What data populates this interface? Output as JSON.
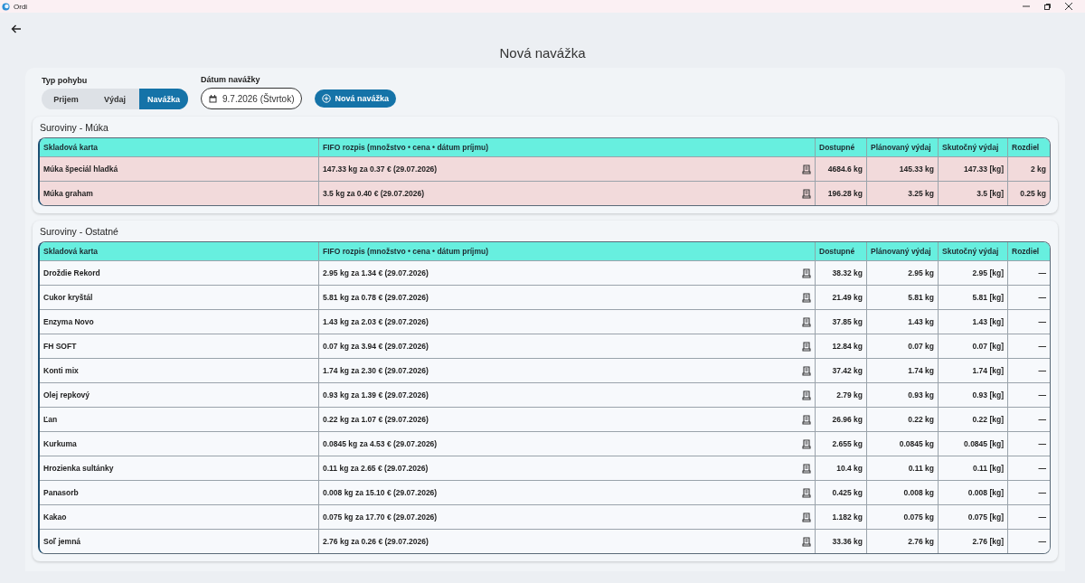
{
  "window": {
    "title": "Ordi"
  },
  "page": {
    "title": "Nová navážka"
  },
  "filters": {
    "movement_type": {
      "label": "Typ pohybu",
      "options": [
        {
          "label": "Prijem",
          "selected": false
        },
        {
          "label": "Výdaj",
          "selected": false
        },
        {
          "label": "Navážka",
          "selected": true
        }
      ]
    },
    "date": {
      "label": "Dátum navážky",
      "value": "9.7.2026 (Štvrtok)"
    },
    "new_button": "Nová navážka"
  },
  "sections": [
    {
      "title": "Suroviny - Múka",
      "columns": [
        "Skladová karta",
        "FIFO rozpis (množstvo • cena • dátum príjmu)",
        "Dostupné",
        "Plánovaný výdaj",
        "Skutočný výdaj",
        "Rozdiel"
      ],
      "rows": [
        {
          "highlighted": true,
          "cells": [
            "Múka špeciál hladká",
            "147.33 kg za 0.37 € (29.07.2026)",
            "4684.6 kg",
            "145.33 kg",
            "147.33 [kg]",
            "2 kg"
          ]
        },
        {
          "highlighted": true,
          "cells": [
            "Múka graham",
            "3.5 kg za 0.40 € (29.07.2026)",
            "196.28 kg",
            "3.25 kg",
            "3.5 [kg]",
            "0.25 kg"
          ]
        }
      ]
    },
    {
      "title": "Suroviny - Ostatné",
      "columns": [
        "Skladová karta",
        "FIFO rozpis (množstvo • cena • dátum príjmu)",
        "Dostupné",
        "Plánovaný výdaj",
        "Skutočný výdaj",
        "Rozdiel"
      ],
      "rows": [
        {
          "highlighted": false,
          "cells": [
            "Droždie Rekord",
            "2.95 kg za 1.34 € (29.07.2026)",
            "38.32 kg",
            "2.95 kg",
            "2.95 [kg]",
            "—"
          ]
        },
        {
          "highlighted": false,
          "cells": [
            "Cukor kryštál",
            "5.81 kg za 0.78 € (29.07.2026)",
            "21.49 kg",
            "5.81 kg",
            "5.81 [kg]",
            "—"
          ]
        },
        {
          "highlighted": false,
          "cells": [
            "Enzyma Novo",
            "1.43 kg za 2.03 € (29.07.2026)",
            "37.85 kg",
            "1.43 kg",
            "1.43 [kg]",
            "—"
          ]
        },
        {
          "highlighted": false,
          "cells": [
            "FH SOFT",
            "0.07 kg za 3.94 € (29.07.2026)",
            "12.84 kg",
            "0.07 kg",
            "0.07 [kg]",
            "—"
          ]
        },
        {
          "highlighted": false,
          "cells": [
            "Konti mix",
            "1.74 kg za 2.30 € (29.07.2026)",
            "37.42 kg",
            "1.74 kg",
            "1.74 [kg]",
            "—"
          ]
        },
        {
          "highlighted": false,
          "cells": [
            "Olej repkový",
            "0.93 kg za 1.39 € (29.07.2026)",
            "2.79 kg",
            "0.93 kg",
            "0.93 [kg]",
            "—"
          ]
        },
        {
          "highlighted": false,
          "cells": [
            "Ľan",
            "0.22 kg za 1.07 € (29.07.2026)",
            "26.96 kg",
            "0.22 kg",
            "0.22 [kg]",
            "—"
          ]
        },
        {
          "highlighted": false,
          "cells": [
            "Kurkuma",
            "0.0845 kg za 4.53 € (29.07.2026)",
            "2.655 kg",
            "0.0845 kg",
            "0.0845 [kg]",
            "—"
          ]
        },
        {
          "highlighted": false,
          "cells": [
            "Hrozienka sultánky",
            "0.11 kg za 2.65 € (29.07.2026)",
            "10.4 kg",
            "0.11 kg",
            "0.11 [kg]",
            "—"
          ]
        },
        {
          "highlighted": false,
          "cells": [
            "Panasorb",
            "0.008 kg za 15.10 € (29.07.2026)",
            "0.425 kg",
            "0.008 kg",
            "0.008 [kg]",
            "—"
          ]
        },
        {
          "highlighted": false,
          "cells": [
            "Kakao",
            "0.075 kg za 17.70 € (29.07.2026)",
            "1.182 kg",
            "0.075 kg",
            "0.075 [kg]",
            "—"
          ]
        },
        {
          "highlighted": false,
          "cells": [
            "Soľ jemná",
            "2.76 kg za 0.26 € (29.07.2026)",
            "33.36 kg",
            "2.76 kg",
            "2.76 [kg]",
            "—"
          ]
        }
      ]
    }
  ]
}
